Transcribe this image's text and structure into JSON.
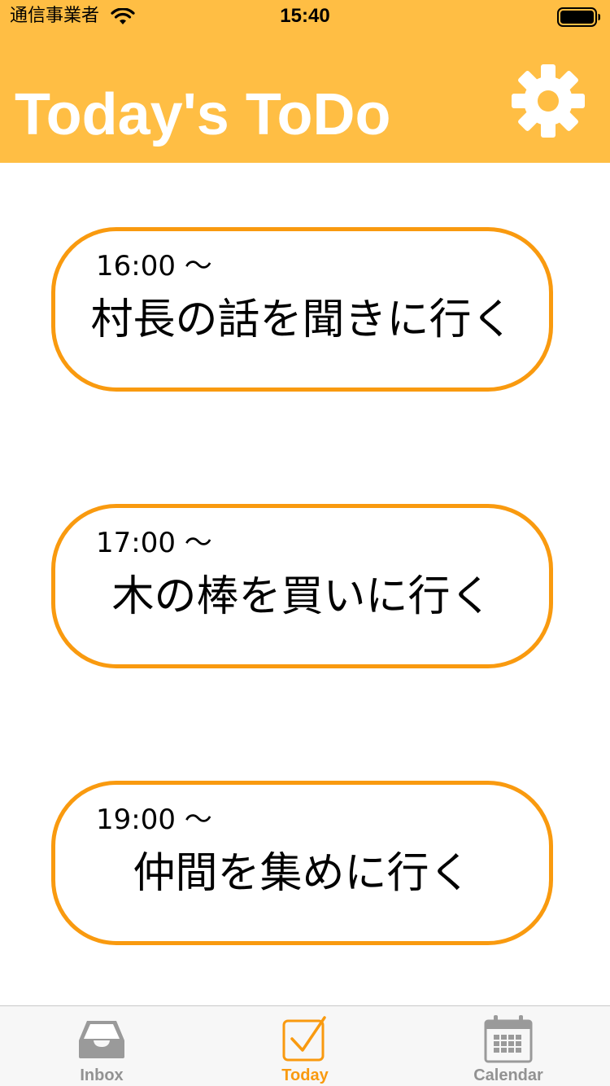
{
  "status_bar": {
    "carrier": "通信事業者",
    "time": "15:40",
    "wifi_icon": "wifi-icon",
    "battery_icon": "battery-icon"
  },
  "header": {
    "title": "Today's ToDo",
    "settings_icon": "gear-icon",
    "background_color": "#FFBE44"
  },
  "todos": [
    {
      "time": "16:00 〜",
      "title": "村長の話を聞きに行く"
    },
    {
      "time": "17:00 〜",
      "title": "木の棒を買いに行く"
    },
    {
      "time": "19:00 〜",
      "title": "仲間を集めに行く"
    }
  ],
  "card_border_color": "#F99A0F",
  "tab_bar": {
    "tabs": [
      {
        "label": "Inbox",
        "icon": "inbox-tray-icon",
        "active": false
      },
      {
        "label": "Today",
        "icon": "checkbox-icon",
        "active": true
      },
      {
        "label": "Calendar",
        "icon": "calendar-icon",
        "active": false
      }
    ],
    "active_color": "#F99A0F",
    "inactive_color": "#929292"
  }
}
